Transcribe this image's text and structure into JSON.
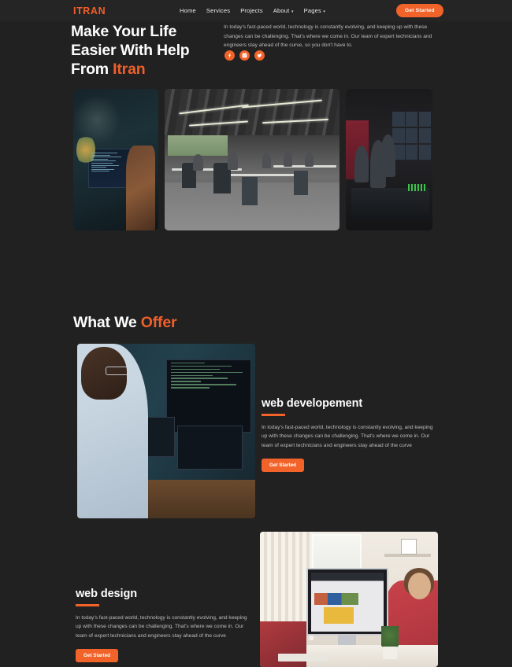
{
  "brand": {
    "logo": "ITRAN",
    "accent_color": "#ef5f2b",
    "background_color": "#212121"
  },
  "navbar": {
    "links": [
      {
        "label": "Home",
        "has_caret": false
      },
      {
        "label": "Services",
        "has_caret": false
      },
      {
        "label": "Projects",
        "has_caret": false
      },
      {
        "label": "About",
        "has_caret": true
      },
      {
        "label": "Pages",
        "has_caret": true
      }
    ],
    "cta_label": "Get Started"
  },
  "hero": {
    "title_line1": "Make Your Life",
    "title_line2": "Easier With Help",
    "title_line3_prefix": "From ",
    "title_line3_accent": "Itran",
    "paragraph": "In today's fast-paced world, technology is constantly evolving, and keeping up with these changes can be challenging. That's where we come in. Our team of expert technicians and engineers stay ahead of the curve, so you don't have to.",
    "socials": [
      {
        "name": "facebook-icon"
      },
      {
        "name": "instagram-icon"
      },
      {
        "name": "twitter-icon"
      }
    ],
    "images": [
      {
        "name": "developer-at-desk-photo",
        "alt": "Developer working at a monitor with code in a dark office"
      },
      {
        "name": "open-plan-office-photo",
        "alt": "Large open-plan office with many people at long desks"
      },
      {
        "name": "broadcast-control-room-photo",
        "alt": "Broadcast control room with multiple monitors and red wall"
      }
    ]
  },
  "offer": {
    "title_prefix": "What We ",
    "title_accent": "Offer"
  },
  "services": [
    {
      "heading": "web developement",
      "paragraph": "In today's fast-paced world, technology is constantly evolving, and keeping up with these changes can be challenging. That's where we come in. Our team of expert technicians and engineers stay ahead of the curve",
      "cta_label": "Get Started",
      "image_name": "coder-multiple-screens-photo",
      "image_alt": "Developer in light blue shirt typing on laptops with code on screens"
    },
    {
      "heading": "web design",
      "paragraph": "In today's fast-paced world, technology is constantly evolving, and keeping up with these changes can be challenging. That's where we come in. Our team of expert technicians and engineers stay ahead of the curve",
      "cta_label": "Get Started",
      "image_name": "designer-imac-office-photo",
      "image_alt": "Bright office with iMac showing design software and woman in red blouse"
    }
  ]
}
